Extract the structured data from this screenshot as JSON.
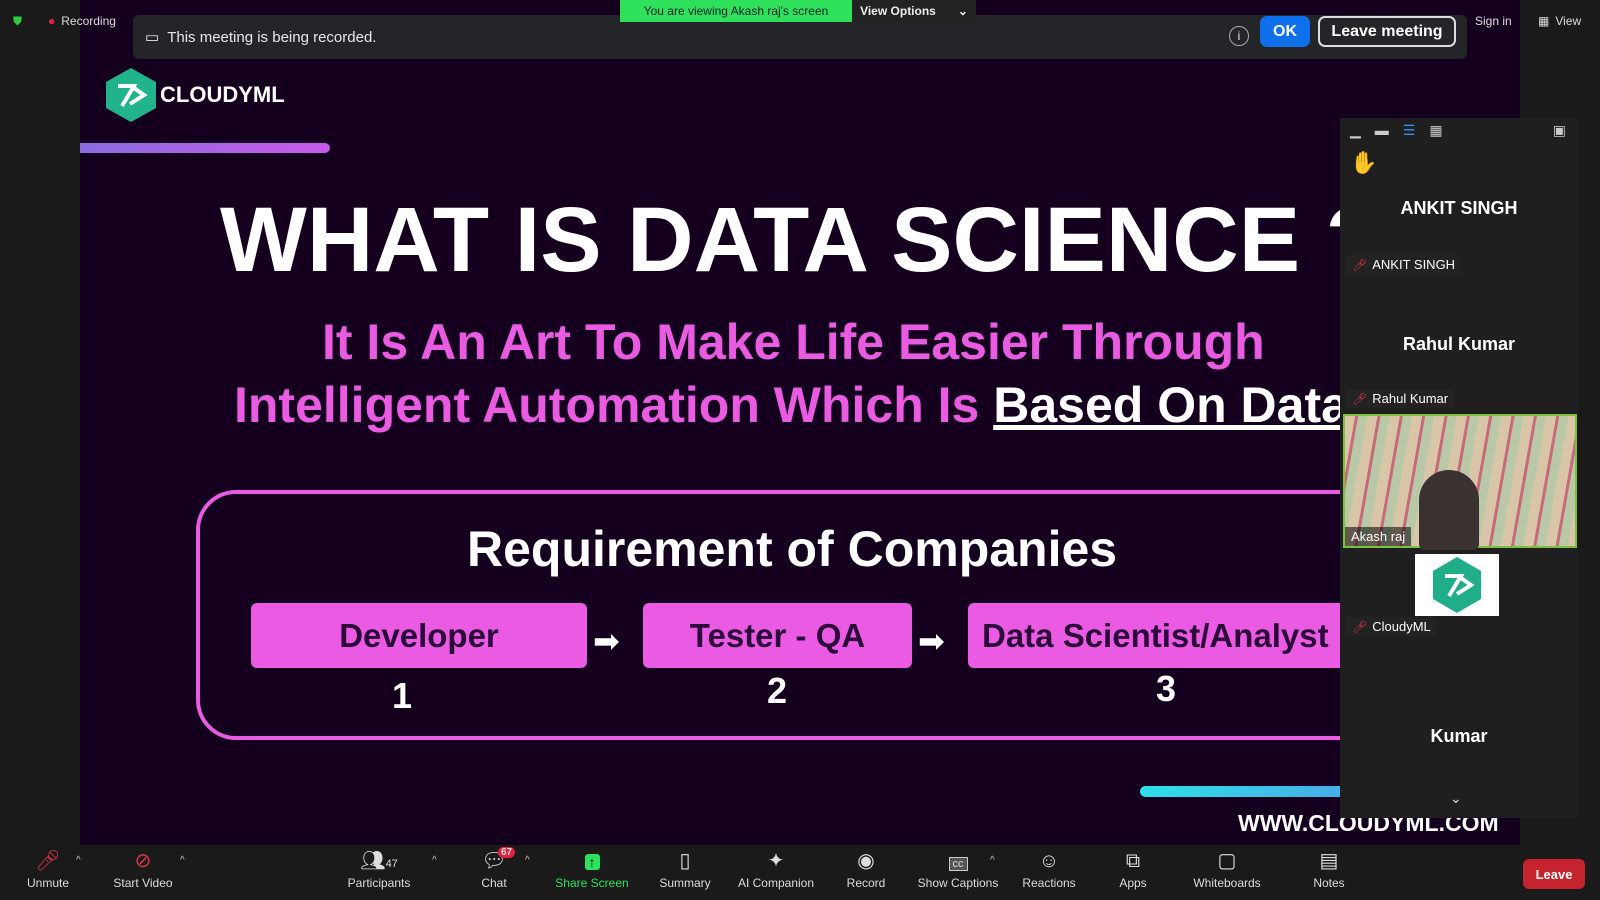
{
  "top": {
    "recording": "Recording",
    "banner_text": "This meeting is being recorded.",
    "viewing": "You are viewing Akash raj's screen",
    "view_options": "View Options",
    "ok": "OK",
    "leave_meeting": "Leave meeting",
    "sign_in": "Sign in",
    "view": "View"
  },
  "slide": {
    "brand": "CLOUDYML",
    "title": "WHAT IS DATA SCIENCE ?",
    "subtitle_line1": "It Is An Art To Make Life Easier Through",
    "subtitle_line2_prefix": "Intelligent Automation Which Is ",
    "subtitle_line2_underlined": "Based On Data",
    "box_title": "Requirement of Companies",
    "steps": [
      {
        "label": "Developer",
        "num": "1"
      },
      {
        "label": "Tester - QA",
        "num": "2"
      },
      {
        "label": "Data Scientist/Analyst",
        "num": "3"
      }
    ],
    "website": "WWW.CLOUDYML.COM"
  },
  "participants": [
    {
      "display": "ANKIT SINGH",
      "name": "ANKIT SINGH"
    },
    {
      "display": "Rahul Kumar",
      "name": "Rahul Kumar"
    },
    {
      "name": "Akash raj"
    },
    {
      "name": "CloudyML"
    },
    {
      "display": "Kumar",
      "name": "Kumar"
    }
  ],
  "toolbar": {
    "unmute": "Unmute",
    "start_video": "Start Video",
    "participants": "Participants",
    "participants_count": "47",
    "chat": "Chat",
    "chat_badge": "67",
    "share_screen": "Share Screen",
    "summary": "Summary",
    "ai_companion": "AI Companion",
    "record": "Record",
    "show_captions": "Show Captions",
    "reactions": "Reactions",
    "apps": "Apps",
    "whiteboards": "Whiteboards",
    "notes": "Notes",
    "leave": "Leave"
  },
  "colors": {
    "slide_bg": "#14001e",
    "pink": "#e95be0",
    "share_green": "#2fe05a",
    "ok_blue": "#0e71eb",
    "leave_red": "#c5242f"
  }
}
